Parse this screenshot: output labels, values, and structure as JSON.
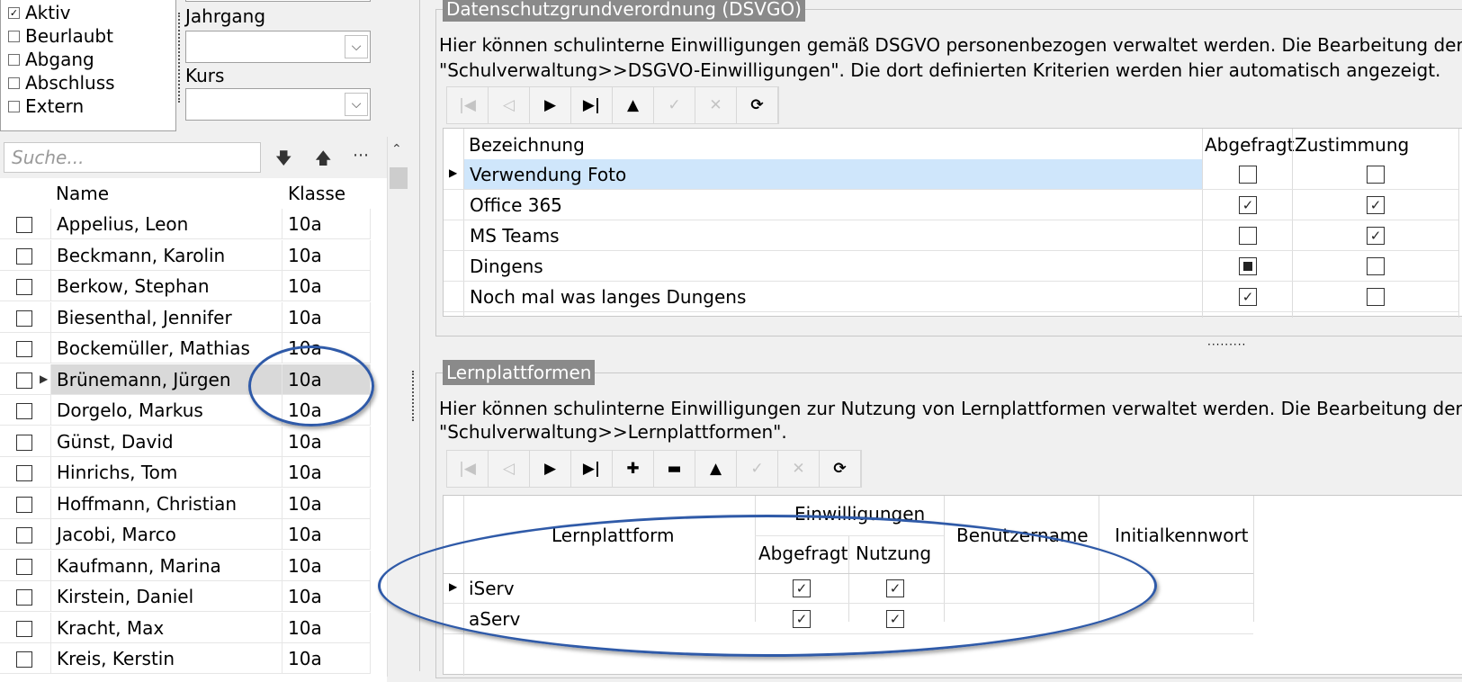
{
  "filters": {
    "status": [
      {
        "label": "Aktiv",
        "checked": true
      },
      {
        "label": "Beurlaubt",
        "checked": false
      },
      {
        "label": "Abgang",
        "checked": false
      },
      {
        "label": "Abschluss",
        "checked": false
      },
      {
        "label": "Extern",
        "checked": false
      }
    ],
    "jahrgang_label": "Jahrgang",
    "kurs_label": "Kurs",
    "jahrgang_value": "",
    "kurs_value": ""
  },
  "search": {
    "placeholder": "Suche..."
  },
  "students": {
    "headers": {
      "name": "Name",
      "klasse": "Klasse"
    },
    "rows": [
      {
        "name": "Appelius, Leon",
        "klasse": "10a"
      },
      {
        "name": "Beckmann, Karolin",
        "klasse": "10a"
      },
      {
        "name": "Berkow, Stephan",
        "klasse": "10a"
      },
      {
        "name": "Biesenthal, Jennifer",
        "klasse": "10a"
      },
      {
        "name": "Bockemüller, Mathias",
        "klasse": "10a"
      },
      {
        "name": "Brünemann, Jürgen",
        "klasse": "10a"
      },
      {
        "name": "Dorgelo, Markus",
        "klasse": "10a"
      },
      {
        "name": "Günst, David",
        "klasse": "10a"
      },
      {
        "name": "Hinrichs, Tom",
        "klasse": "10a"
      },
      {
        "name": "Hoffmann, Christian",
        "klasse": "10a"
      },
      {
        "name": "Jacobi, Marco",
        "klasse": "10a"
      },
      {
        "name": "Kaufmann, Marina",
        "klasse": "10a"
      },
      {
        "name": "Kirstein, Daniel",
        "klasse": "10a"
      },
      {
        "name": "Kracht, Max",
        "klasse": "10a"
      },
      {
        "name": "Kreis, Kerstin",
        "klasse": "10a"
      }
    ],
    "selected_index": 5
  },
  "dsgvo": {
    "title": "Datenschutzgrundverordnung (DSVGO)",
    "desc_line1": "Hier können schulinterne Einwilligungen gemäß DSGVO personenbezogen verwaltet werden. Die Bearbeitung der verfü",
    "desc_line2": "\"Schulverwaltung>>DSGVO-Einwilligungen\". Die dort definierten Kriterien werden hier automatisch angezeigt.",
    "headers": {
      "bezeichnung": "Bezeichnung",
      "abgefragt": "Abgefragt",
      "zustimmung": "Zustimmung"
    },
    "rows": [
      {
        "bezeichnung": "Verwendung Foto",
        "abgefragt": "unchecked",
        "zustimmung": "unchecked"
      },
      {
        "bezeichnung": "Office 365",
        "abgefragt": "checked",
        "zustimmung": "checked"
      },
      {
        "bezeichnung": "MS Teams",
        "abgefragt": "unchecked",
        "zustimmung": "checked"
      },
      {
        "bezeichnung": "Dingens",
        "abgefragt": "indeterminate",
        "zustimmung": "unchecked"
      },
      {
        "bezeichnung": "Noch mal was langes Dungens",
        "abgefragt": "checked",
        "zustimmung": "unchecked"
      }
    ]
  },
  "lernplattformen": {
    "title": "Lernplattformen",
    "desc_line1": "Hier können schulinterne Einwilligungen zur Nutzung von Lernplattformen verwaltet werden. Die Bearbeitung der verfü",
    "desc_line2": "\"Schulverwaltung>>Lernplattformen\".",
    "headers": {
      "lernplattform": "Lernplattform",
      "einwilligungen": "Einwilligungen",
      "abgefragt": "Abgefragt",
      "nutzung": "Nutzung",
      "benutzername": "Benutzername",
      "initialkennwort": "Initialkennwort"
    },
    "rows": [
      {
        "name": "iServ",
        "abgefragt": true,
        "nutzung": true,
        "benutzername": "",
        "initialkennwort": ""
      },
      {
        "name": "aServ",
        "abgefragt": true,
        "nutzung": true,
        "benutzername": "",
        "initialkennwort": ""
      }
    ]
  },
  "colors": {
    "annotation_oval": "#2f5aa8",
    "group_title_bg": "#8a8a8a",
    "selected_row": "#cfe6fb"
  }
}
